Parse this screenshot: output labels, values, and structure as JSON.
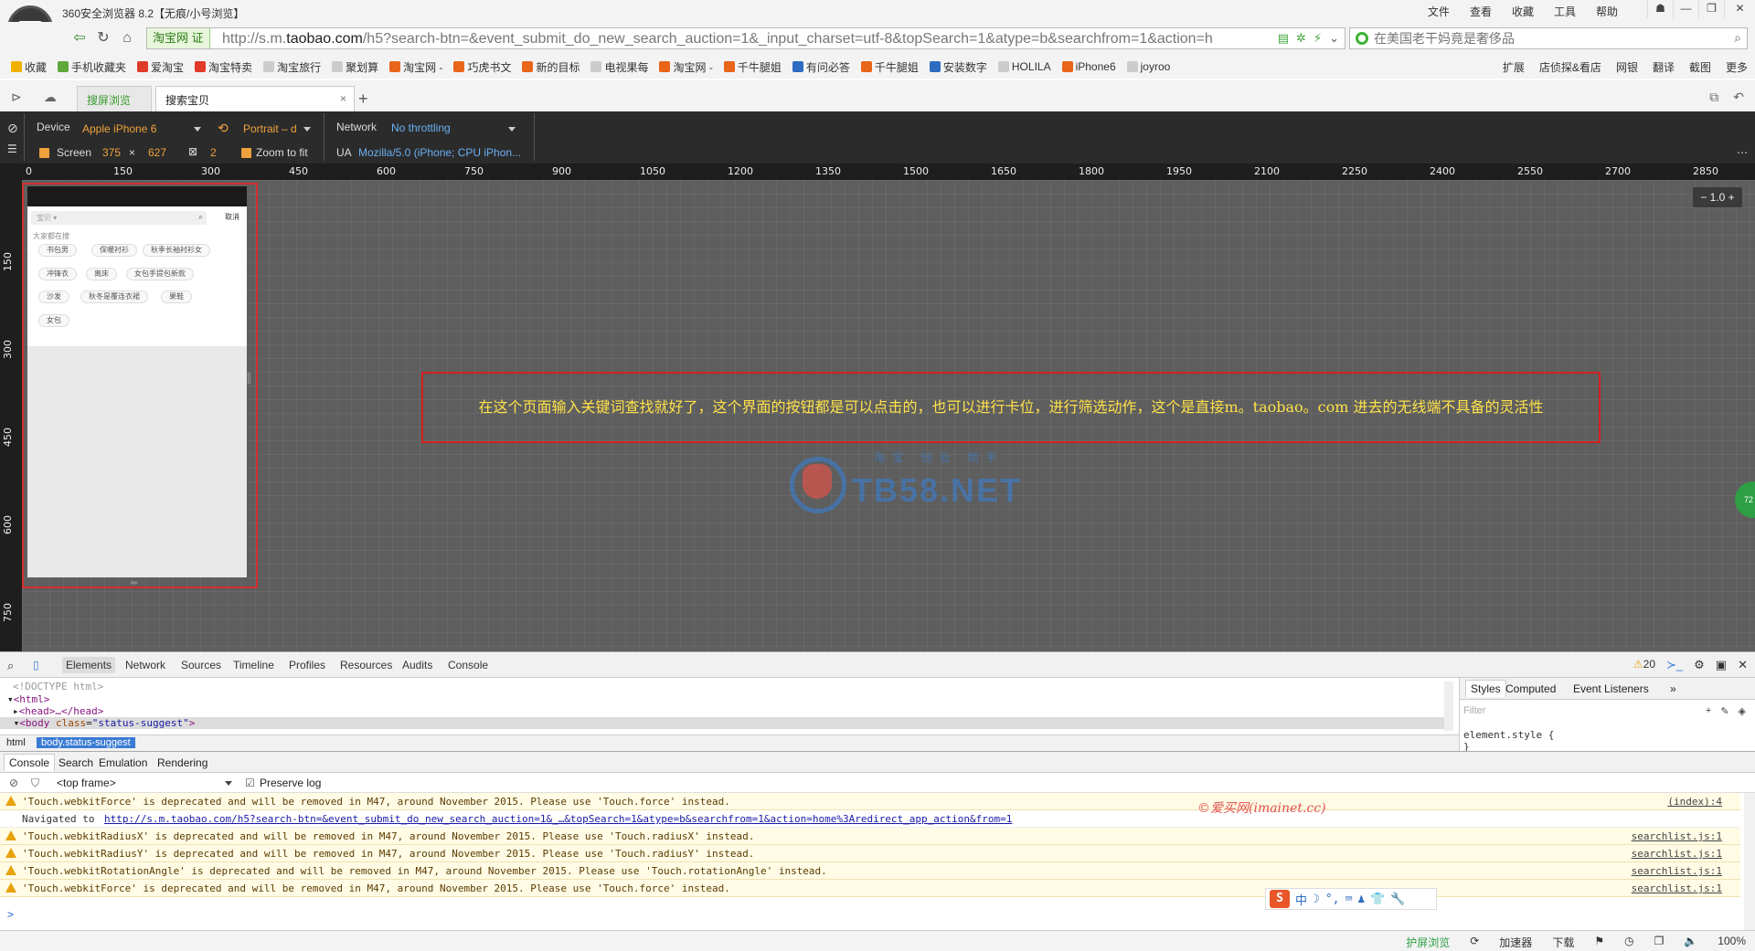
{
  "window": {
    "title": "360安全浏览器 8.2【无痕/小号浏览】",
    "menu": [
      "文件",
      "查看",
      "收藏",
      "工具",
      "帮助"
    ],
    "controls": [
      "☗",
      "—",
      "❐",
      "✕"
    ]
  },
  "addressbar": {
    "site_badge": "淘宝网 证",
    "url_prefix": "http://s.m.",
    "url_domain": "taobao.com",
    "url_rest": "/h5?search-btn=&event_submit_do_new_search_auction=1&_input_charset=utf-8&topSearch=1&atype=b&searchfrom=1&action=h",
    "search_placeholder": "在美国老干妈竟是奢侈品"
  },
  "bookmarks": {
    "items": [
      {
        "label": "收藏",
        "color": "#f0b000"
      },
      {
        "label": "手机收藏夹",
        "color": "#5fa83a"
      },
      {
        "label": "爱淘宝",
        "color": "#e03a2a"
      },
      {
        "label": "淘宝特卖",
        "color": "#e03a2a"
      },
      {
        "label": "淘宝旅行",
        "color": "#bbbbbb"
      },
      {
        "label": "聚划算",
        "color": "#bbbbbb"
      },
      {
        "label": "淘宝网 -",
        "color": "#e8651a"
      },
      {
        "label": "巧虎书文",
        "color": "#e8651a"
      },
      {
        "label": "新的目标",
        "color": "#e8651a"
      },
      {
        "label": "电视果每",
        "color": "#bbbbbb"
      },
      {
        "label": "淘宝网 -",
        "color": "#e8651a"
      },
      {
        "label": "千牛腿姐",
        "color": "#e8651a"
      },
      {
        "label": "有问必答",
        "color": "#2d6cc0"
      },
      {
        "label": "千牛腿姐",
        "color": "#e8651a"
      },
      {
        "label": "安装数字",
        "color": "#2d6cc0"
      },
      {
        "label": "HOLILA",
        "color": "#bbbbbb"
      },
      {
        "label": "iPhone6",
        "color": "#e8651a"
      },
      {
        "label": "joyroo",
        "color": "#bbbbbb"
      }
    ],
    "right": [
      "扩展",
      "店侦探&看店",
      "网银",
      "翻译",
      "截图",
      "更多"
    ]
  },
  "tabs": {
    "green_tab": "搜屏浏览",
    "active_tab": "搜索宝贝",
    "close": "×",
    "new": "+"
  },
  "devbar": {
    "device_label": "Device",
    "device_value": "Apple iPhone 6",
    "orientation_value": "Portrait – d",
    "network_label": "Network",
    "network_value": "No throttling",
    "screen_label": "Screen",
    "screen_w": "375",
    "screen_x": "×",
    "screen_h": "627",
    "dpr": "2",
    "zoom_to_fit": "Zoom to fit",
    "ua_label": "UA",
    "ua_value": "Mozilla/5.0 (iPhone; CPU iPhon..."
  },
  "ruler": {
    "top": [
      "0",
      "150",
      "300",
      "450",
      "600",
      "750",
      "900",
      "1050",
      "1200",
      "1350",
      "1500",
      "1650",
      "1800",
      "1950",
      "2100",
      "2250",
      "2400",
      "2550",
      "2700",
      "2850"
    ],
    "left": [
      "150",
      "300",
      "450",
      "600",
      "750"
    ]
  },
  "phone": {
    "search_placeholder": "宝贝 ▾",
    "cancel": "取消",
    "section_title": "大家都在搜",
    "chips": [
      "书包男",
      "保暖衬衫",
      "秋季长袖衬衫女",
      "冲锋衣",
      "离床",
      "女包手提包新款",
      "沙发",
      "秋冬是覆连衣裙",
      "果鞋",
      "女包"
    ]
  },
  "canvas": {
    "annotation": "在这个页面输入关键词查找就好了，这个界面的按钮都是可以点击的，也可以进行卡位，进行筛选动作，这个是直接m。taobao。com 进去的无线端不具备的灵活性",
    "watermark_text": "TB58.NET",
    "watermark_sub": "淘宝 创业 助手",
    "zoom_value": "1.0",
    "side_badge": "72"
  },
  "devtools": {
    "tabs": [
      "Elements",
      "Network",
      "Sources",
      "Timeline",
      "Profiles",
      "Resources",
      "Audits",
      "Console"
    ],
    "warn_count": "20",
    "elements": {
      "doctype": "<!DOCTYPE html>",
      "html_open": "<html>",
      "head": "<head>…</head>",
      "body_tag": "<body",
      "body_attr": "class",
      "body_val": "\"status-suggest\"",
      "body_close": ">"
    },
    "crumbs": [
      "html",
      "body.status-suggest"
    ],
    "styles_tabs": [
      "Styles",
      "Computed",
      "Event Listeners",
      "»"
    ],
    "filter_placeholder": "Filter",
    "style_rule_1": "element.style {",
    "style_rule_2": "}"
  },
  "console": {
    "tabs": [
      "Console",
      "Search",
      "Emulation",
      "Rendering"
    ],
    "frame": "<top frame>",
    "preserve_log": "Preserve log",
    "messages": [
      {
        "type": "warn",
        "text": "'Touch.webkitForce' is deprecated and will be removed in M47, around November 2015. Please use 'Touch.force' instead.",
        "source": "(index):4"
      },
      {
        "type": "nav",
        "text": "Navigated to ",
        "link": "http://s.m.taobao.com/h5?search-btn=&event_submit_do_new_search_auction=1&_…&topSearch=1&atype=b&searchfrom=1&action=home%3Aredirect_app_action&from=1",
        "source": ""
      },
      {
        "type": "warn",
        "text": "'Touch.webkitRadiusX' is deprecated and will be removed in M47, around November 2015. Please use 'Touch.radiusX' instead.",
        "source": "searchlist.js:1"
      },
      {
        "type": "warn",
        "text": "'Touch.webkitRadiusY' is deprecated and will be removed in M47, around November 2015. Please use 'Touch.radiusY' instead.",
        "source": "searchlist.js:1"
      },
      {
        "type": "warn",
        "text": "'Touch.webkitRotationAngle' is deprecated and will be removed in M47, around November 2015. Please use 'Touch.rotationAngle' instead.",
        "source": "searchlist.js:1"
      },
      {
        "type": "warn",
        "text": "'Touch.webkitForce' is deprecated and will be removed in M47, around November 2015. Please use 'Touch.force' instead.",
        "source": "searchlist.js:1"
      }
    ],
    "watermark": "©爱买网(imainet.cc)",
    "prompt": ">",
    "ime": [
      "中",
      "☽",
      "°,",
      "⌨",
      "♟",
      "👕",
      "🔧"
    ]
  },
  "statusbar": {
    "items": [
      "护屏浏览",
      "⟳",
      "加速器",
      "下载",
      "⚑",
      "◷",
      "❐",
      "🔈",
      "100%"
    ]
  }
}
